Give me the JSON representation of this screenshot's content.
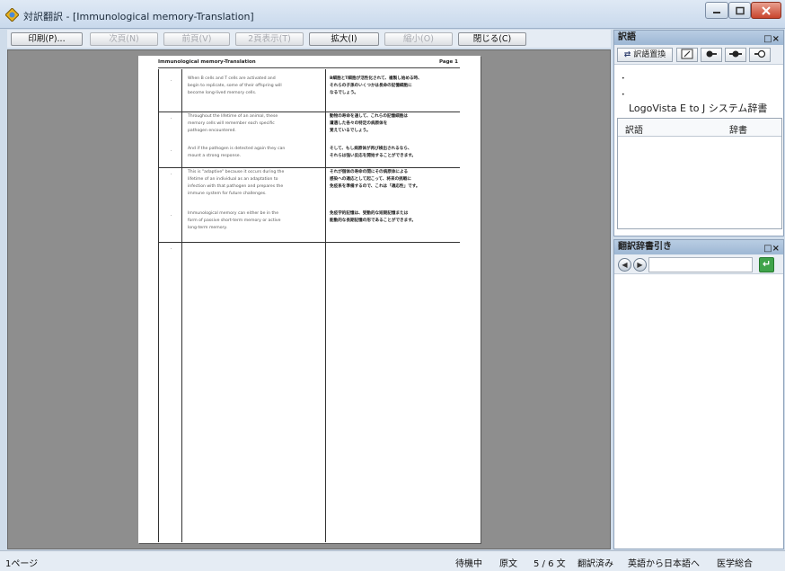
{
  "window": {
    "title": "対訳翻訳 - [Immunological memory-Translation]"
  },
  "toolbar": {
    "buttons": [
      {
        "label": "印刷(P)...",
        "enabled": true
      },
      {
        "label": "次頁(N)",
        "enabled": false
      },
      {
        "label": "前頁(V)",
        "enabled": false
      },
      {
        "label": "2頁表示(T)",
        "enabled": false
      },
      {
        "label": "拡大(I)",
        "enabled": true
      },
      {
        "label": "縮小(O)",
        "enabled": false
      },
      {
        "label": "閉じる(C)",
        "enabled": true
      }
    ]
  },
  "document": {
    "header_title": "Immunological memory-Translation",
    "header_page": "Page 1",
    "rows": [
      {
        "en": "When B cells and T cells are activated and\nbegin to replicate, some of their offspring will\nbecome long-lived memory cells.",
        "ja": "B細胞とT細胞が活性化されて、複製し始める時、\nそれらの子孫のいくつかは長命の記憶細胞に\nなるでしょう。"
      },
      {
        "en": "Throughout the lifetime of an animal, these\nmemory cells will remember each specific\npathogen encountered.",
        "ja": "動物の寿命を通して、これらの記憶細胞は\n遭遇した各々の特定の病原体を\n覚えているでしょう。"
      },
      {
        "en": "And if the pathogen is detected again they can\nmount a strong response.",
        "ja": "そして、もし病原体が再び検出されるなら、\nそれらは強い反応を開始することができます。"
      },
      {
        "en": "This is \"adaptive\" because it occurs during the\nlifetime of an individual as an adaptation to\ninfection with that pathogen and prepares the\nimmune system for future challenges.",
        "ja": "それが個体の寿命の間にその病原体による\n感染への適応として起こって、将来の挑戦に\n免疫系を準備するので、これは「適応性」です。"
      },
      {
        "en": "Immunological memory can either be in the\nform of passive short-term memory or active\nlong-term memory.",
        "ja": "免疫学的記憶は、受動的な短期記憶または\n能動的な長期記憶の形であることができます。"
      }
    ]
  },
  "dict_panel": {
    "title": "訳語",
    "replace_label": "訳語置換",
    "dictionary_name": "LogoVista E to J システム辞書",
    "col_translation": "訳語",
    "col_dictionary": "辞書"
  },
  "lookup_panel": {
    "title": "翻訳辞書引き",
    "enter_symbol": "↵"
  },
  "status": {
    "page": "1ページ",
    "waiting": "待機中",
    "source": "原文",
    "sentence_count": "5 / 6 文",
    "translated": "翻訳済み",
    "direction": "英語から日本語へ",
    "field": "医学総合"
  }
}
